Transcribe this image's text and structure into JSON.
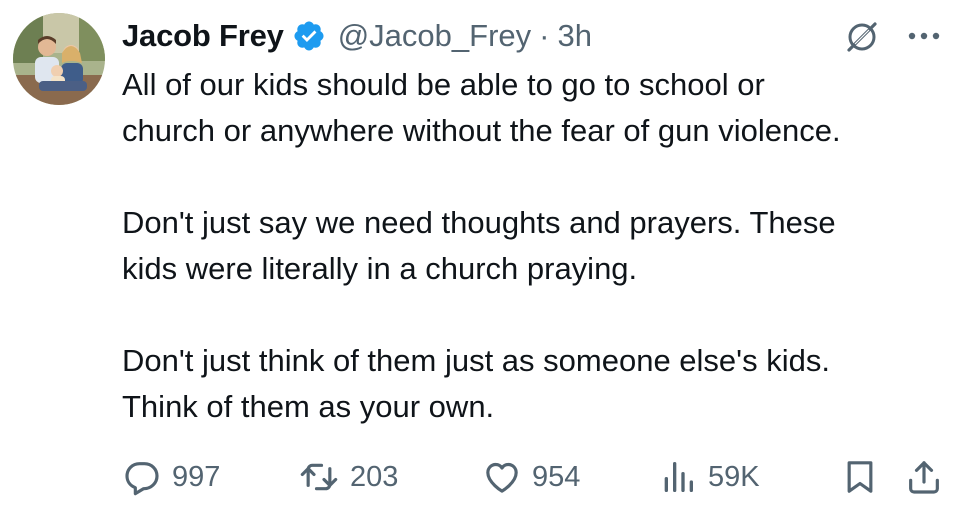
{
  "tweet": {
    "author": {
      "display_name": "Jacob Frey",
      "handle": "@Jacob_Frey",
      "separator": "·",
      "time": "3h",
      "verified": true
    },
    "text": {
      "p1_line1": "All of our kids should be able to go to school or",
      "p1_line2": "church or anywhere without the fear of gun violence.",
      "p2_line1": "Don't just say we need thoughts and prayers. These",
      "p2_line2": "kids were literally in a church praying.",
      "p3_line1": "Don't just think of them just as someone else's kids.",
      "p3_line2": "Think of them as your own."
    },
    "actions": {
      "replies": "997",
      "reposts": "203",
      "likes": "954",
      "views": "59K"
    },
    "icons": {
      "verified": "verified-badge-icon",
      "grok": "grok-icon",
      "more": "more-icon",
      "reply": "reply-icon",
      "repost": "repost-icon",
      "like": "heart-icon",
      "views": "views-icon",
      "bookmark": "bookmark-icon",
      "share": "share-icon"
    },
    "colors": {
      "text": "#0f1419",
      "secondary": "#536471",
      "verified_blue": "#1d9bf0",
      "background": "#ffffff"
    }
  }
}
